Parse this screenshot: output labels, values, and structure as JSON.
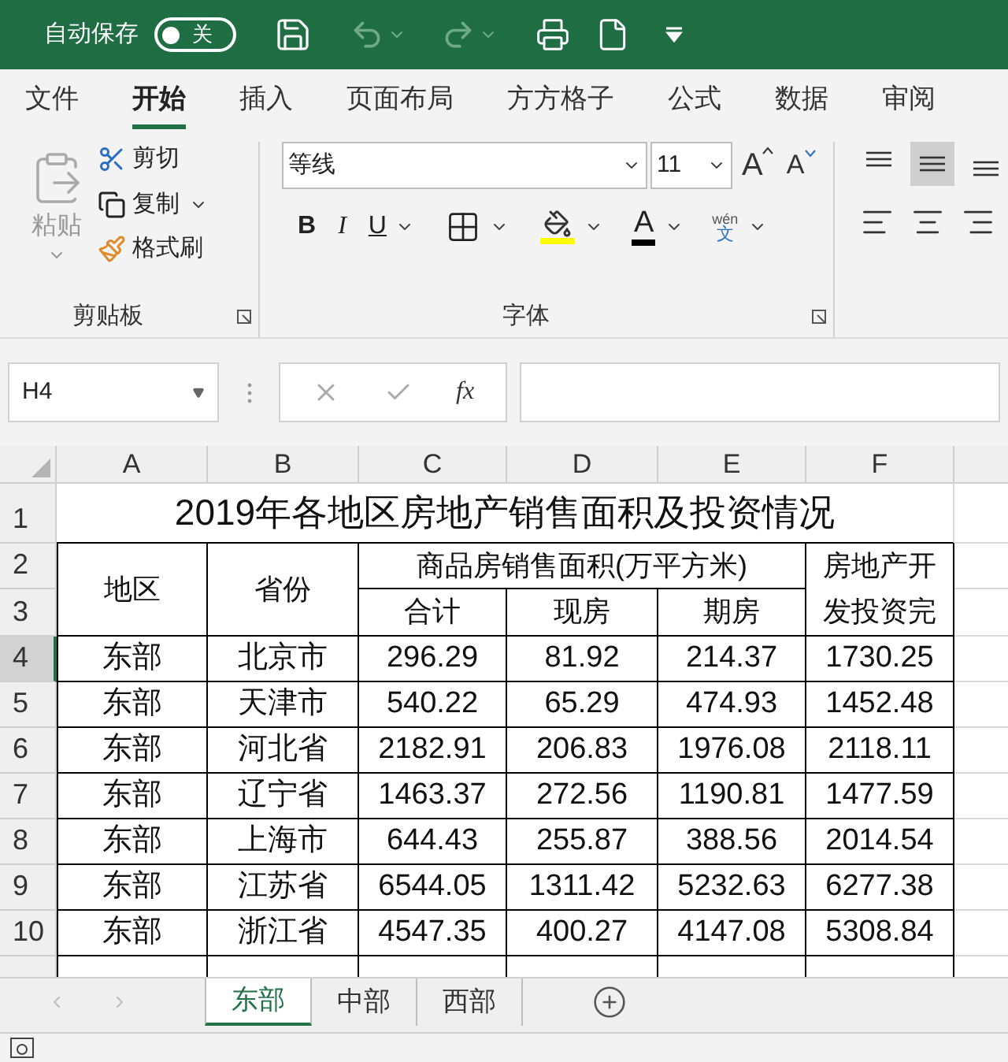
{
  "title_bar": {
    "autosave_label": "自动保存",
    "autosave_toggle": {
      "label": "关",
      "on": false
    }
  },
  "ribbon_tabs": [
    {
      "label": "文件",
      "selected": false
    },
    {
      "label": "开始",
      "selected": true
    },
    {
      "label": "插入",
      "selected": false
    },
    {
      "label": "页面布局",
      "selected": false
    },
    {
      "label": "方方格子",
      "selected": false
    },
    {
      "label": "公式",
      "selected": false
    },
    {
      "label": "数据",
      "selected": false
    },
    {
      "label": "审阅",
      "selected": false
    }
  ],
  "clipboard": {
    "paste": "粘贴",
    "cut": "剪切",
    "copy": "复制",
    "format_painter": "格式刷",
    "group_label": "剪贴板"
  },
  "font": {
    "name": "等线",
    "size": "11",
    "grow": "A",
    "shrink": "A",
    "bold": "B",
    "italic": "I",
    "underline": "U",
    "font_color": "A",
    "phonetic_top": "wén",
    "phonetic_bottom": "文",
    "group_label": "字体"
  },
  "alignment": {
    "vertical": [
      {
        "selected": false
      },
      {
        "selected": true
      },
      {
        "selected": false
      }
    ]
  },
  "formula_bar": {
    "name_box": "H4",
    "fx": "fx"
  },
  "sheet": {
    "columns": [
      "A",
      "B",
      "C",
      "D",
      "E",
      "F"
    ],
    "row_numbers": [
      {
        "label": "1",
        "selected": false
      },
      {
        "label": "2",
        "selected": false
      },
      {
        "label": "3",
        "selected": false
      },
      {
        "label": "4",
        "selected": true
      },
      {
        "label": "5",
        "selected": false
      },
      {
        "label": "6",
        "selected": false
      },
      {
        "label": "7",
        "selected": false
      },
      {
        "label": "8",
        "selected": false
      },
      {
        "label": "9",
        "selected": false
      },
      {
        "label": "10",
        "selected": false
      }
    ],
    "title": "2019年各地区房地产销售面积及投资情况",
    "header": {
      "region": "地区",
      "province": "省份",
      "sales_area": "商品房销售面积(万平方米)",
      "total": "合计",
      "existing": "现房",
      "presale": "期房",
      "investment_line1": "房地产开",
      "investment_line2": "发投资完"
    },
    "rows": [
      [
        "东部",
        "北京市",
        "296.29",
        "81.92",
        "214.37",
        "1730.25"
      ],
      [
        "东部",
        "天津市",
        "540.22",
        "65.29",
        "474.93",
        "1452.48"
      ],
      [
        "东部",
        "河北省",
        "2182.91",
        "206.83",
        "1976.08",
        "2118.11"
      ],
      [
        "东部",
        "辽宁省",
        "1463.37",
        "272.56",
        "1190.81",
        "1477.59"
      ],
      [
        "东部",
        "上海市",
        "644.43",
        "255.87",
        "388.56",
        "2014.54"
      ],
      [
        "东部",
        "江苏省",
        "6544.05",
        "1311.42",
        "5232.63",
        "6277.38"
      ],
      [
        "东部",
        "浙江省",
        "4547.35",
        "400.27",
        "4147.08",
        "5308.84"
      ]
    ]
  },
  "sheet_tabs": [
    {
      "label": "东部",
      "selected": true
    },
    {
      "label": "中部",
      "selected": false
    },
    {
      "label": "西部",
      "selected": false
    }
  ]
}
